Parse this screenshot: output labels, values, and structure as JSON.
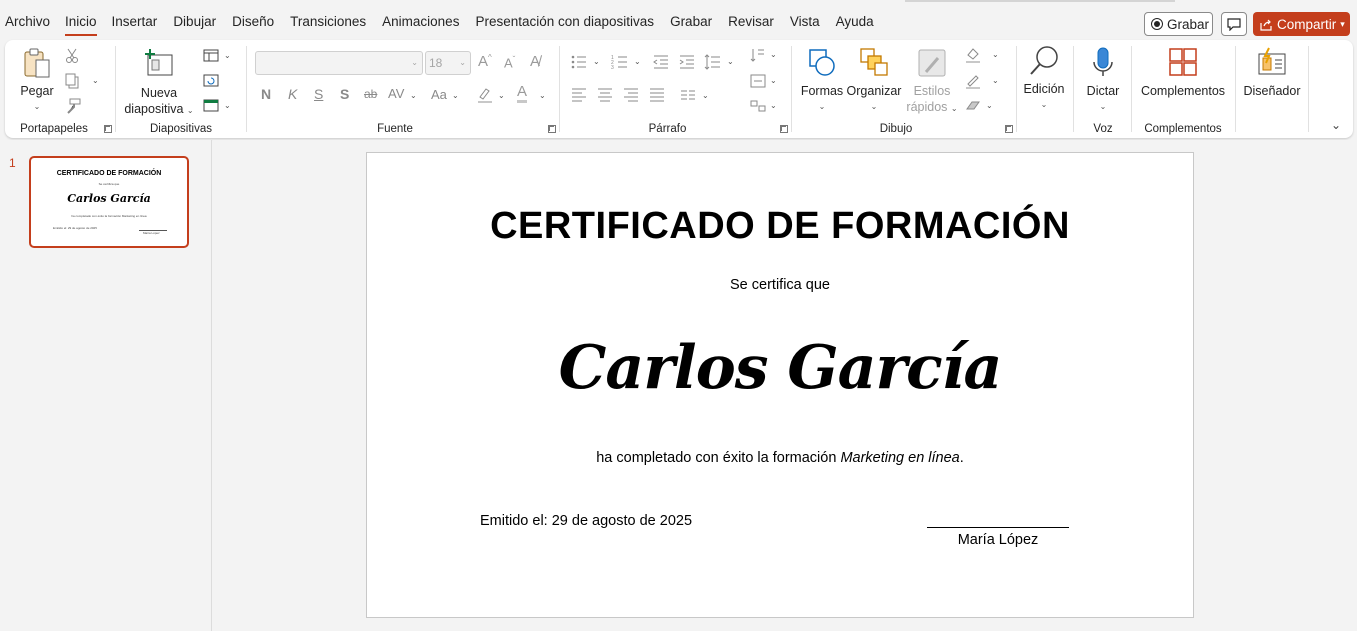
{
  "menu": {
    "tabs": [
      "Archivo",
      "Inicio",
      "Insertar",
      "Dibujar",
      "Diseño",
      "Transiciones",
      "Animaciones",
      "Presentación con diapositivas",
      "Grabar",
      "Revisar",
      "Vista",
      "Ayuda"
    ],
    "active_tab": "Inicio",
    "record_label": "Grabar",
    "share_label": "Compartir",
    "accent_color": "#c43e1c"
  },
  "ribbon": {
    "clipboard": {
      "paste_label": "Pegar",
      "group_label": "Portapapeles"
    },
    "slides": {
      "new_slide_label_1": "Nueva",
      "new_slide_label_2": "diapositiva",
      "group_label": "Diapositivas"
    },
    "font": {
      "font_name": "",
      "font_size": "18",
      "group_label": "Fuente",
      "bold": "N",
      "italic": "K",
      "underline": "S",
      "shadow": "S",
      "strike": "ab",
      "spacing": "AV",
      "case": "Aa"
    },
    "paragraph": {
      "group_label": "Párrafo"
    },
    "drawing": {
      "shapes_label": "Formas",
      "arrange_label": "Organizar",
      "styles_label_1": "Estilos",
      "styles_label_2": "rápidos",
      "group_label": "Dibujo"
    },
    "editing": {
      "label": "Edición"
    },
    "voice": {
      "dictate_label": "Dictar",
      "group_label": "Voz"
    },
    "addins": {
      "label": "Complementos",
      "group_label": "Complementos"
    },
    "designer": {
      "label": "Diseñador"
    }
  },
  "thumbnails": [
    {
      "number": "1"
    }
  ],
  "slide": {
    "title": "CERTIFICADO DE FORMACIÓN",
    "subtitle": "Se certifica que",
    "recipient": "Carlos García",
    "body_prefix": "ha completado con éxito la formación ",
    "course": "Marketing en línea",
    "body_suffix": ".",
    "issued": "Emitido el: 29 de agosto de 2025",
    "signer": "María López"
  }
}
